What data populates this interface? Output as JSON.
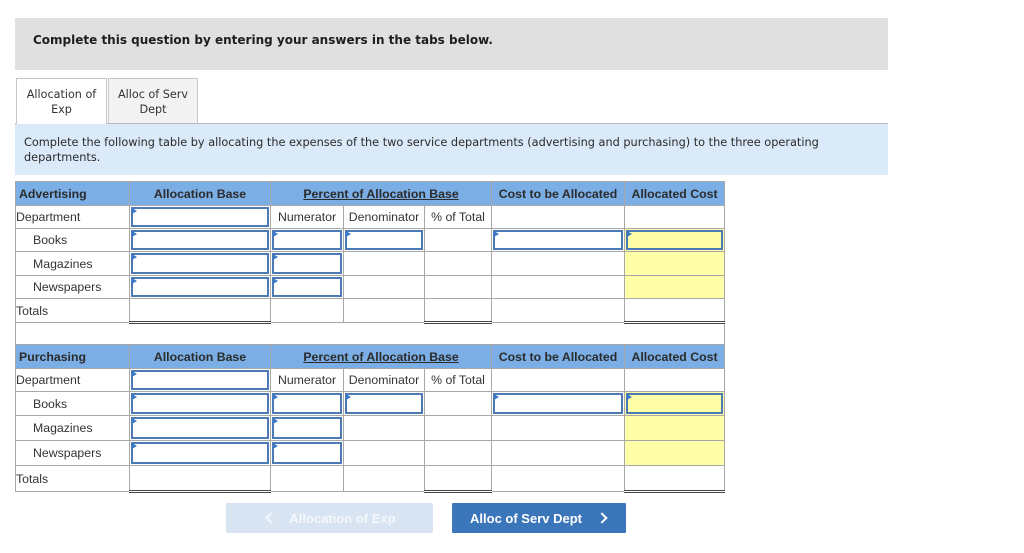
{
  "page": {
    "instruction_banner": "Complete this question by entering your answers in the tabs below."
  },
  "tabs": [
    {
      "label_lines": [
        "Allocation of",
        "Exp"
      ],
      "active": true
    },
    {
      "label_lines": [
        "Alloc of Serv",
        "Dept"
      ],
      "active": false
    }
  ],
  "instructions": "Complete the following table by allocating the expenses of the two service departments (advertising and purchasing) to the three operating departments.",
  "columns": {
    "allocation_base": "Allocation Base",
    "percent_of_allocation_base": "Percent of Allocation Base",
    "cost_to_be_allocated": "Cost to be Allocated",
    "allocated_cost": "Allocated Cost",
    "department": "Department",
    "numerator": "Numerator",
    "denominator": "Denominator",
    "percent_of_total": "% of Total"
  },
  "sections": [
    {
      "service_department": "Advertising",
      "department_row": {
        "allocation_base": ""
      },
      "rows": [
        {
          "label": "Books",
          "allocation_base": "",
          "numerator": "",
          "denominator": "",
          "percent_of_total": "",
          "cost_to_be_allocated": "",
          "allocated_cost": ""
        },
        {
          "label": "Magazines",
          "allocation_base": "",
          "numerator": "",
          "denominator": "",
          "percent_of_total": "",
          "cost_to_be_allocated": "",
          "allocated_cost": ""
        },
        {
          "label": "Newspapers",
          "allocation_base": "",
          "numerator": "",
          "denominator": "",
          "percent_of_total": "",
          "cost_to_be_allocated": "",
          "allocated_cost": ""
        }
      ],
      "totals": {
        "label": "Totals",
        "allocation_base": "",
        "percent_of_total": "",
        "allocated_cost": ""
      }
    },
    {
      "service_department": "Purchasing",
      "department_row": {
        "allocation_base": ""
      },
      "rows": [
        {
          "label": "Books",
          "allocation_base": "",
          "numerator": "",
          "denominator": "",
          "percent_of_total": "",
          "cost_to_be_allocated": "",
          "allocated_cost": ""
        },
        {
          "label": "Magazines",
          "allocation_base": "",
          "numerator": "",
          "denominator": "",
          "percent_of_total": "",
          "cost_to_be_allocated": "",
          "allocated_cost": ""
        },
        {
          "label": "Newspapers",
          "allocation_base": "",
          "numerator": "",
          "denominator": "",
          "percent_of_total": "",
          "cost_to_be_allocated": "",
          "allocated_cost": ""
        }
      ],
      "totals": {
        "label": "Totals",
        "allocation_base": "",
        "percent_of_total": "",
        "allocated_cost": ""
      }
    }
  ],
  "navigation": {
    "prev": {
      "label": "Allocation of Exp",
      "enabled": false,
      "icon": "chevron-left-icon"
    },
    "next": {
      "label": "Alloc of Serv Dept",
      "enabled": true,
      "icon": "chevron-right-icon"
    }
  },
  "colors": {
    "header_blue": "#7aaee5",
    "input_border": "#4c7ab5",
    "input_marker": "#3a78c9",
    "computed_cell_yellow": "#ffffa8",
    "instructions_background": "#dbeaf8",
    "banner_background": "#e0e0e0",
    "next_button": "#3b75ba",
    "prev_button_disabled": "#d8e4f1"
  }
}
